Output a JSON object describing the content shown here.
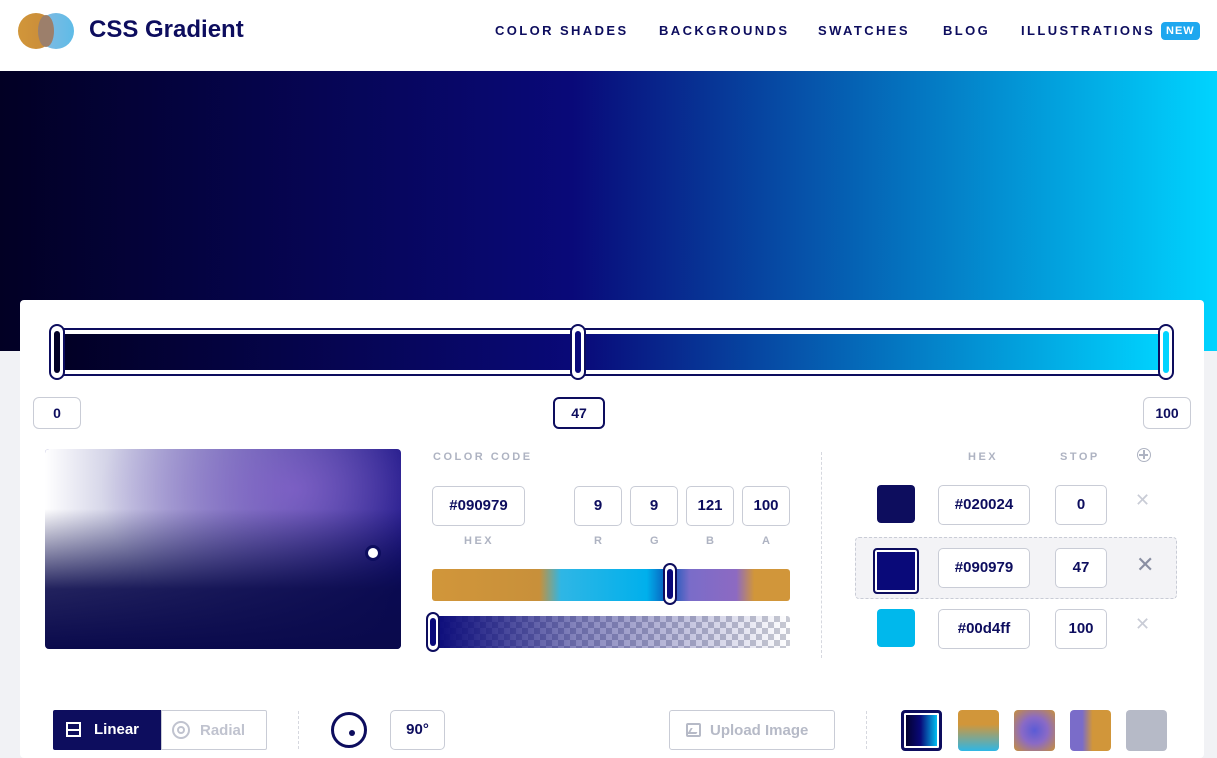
{
  "header": {
    "brand": "CSS Gradient",
    "nav": [
      "COLOR SHADES",
      "BACKGROUNDS",
      "SWATCHES",
      "BLOG",
      "ILLUSTRATIONS"
    ],
    "badge": "NEW"
  },
  "colors": {
    "stop_0": "#020024",
    "stop_1": "#090979",
    "stop_2": "#00d4ff",
    "accent": "#0d0d5e",
    "badge_bg": "#1ea7ef"
  },
  "slider": {
    "positions": [
      "0",
      "47",
      "100"
    ],
    "active_index": 1
  },
  "color_code": {
    "label": "COLOR CODE",
    "hex_value": "#090979",
    "r": "9",
    "g": "9",
    "b": "121",
    "a": "100",
    "labels": {
      "hex": "HEX",
      "r": "R",
      "g": "G",
      "b": "B",
      "a": "A"
    }
  },
  "stops_table": {
    "headers": {
      "hex": "HEX",
      "stop": "STOP"
    },
    "add_icon": "plus-circle-icon",
    "rows": [
      {
        "hex": "#020024",
        "stop": "0"
      },
      {
        "hex": "#090979",
        "stop": "47"
      },
      {
        "hex": "#00d4ff",
        "stop": "100"
      }
    ]
  },
  "controls": {
    "linear_label": "Linear",
    "radial_label": "Radial",
    "angle": "90°",
    "upload_label": "Upload Image"
  },
  "presets": [
    "dark-blue-cyan",
    "orange-cyan",
    "purple-radial",
    "purple-orange",
    "grey"
  ]
}
